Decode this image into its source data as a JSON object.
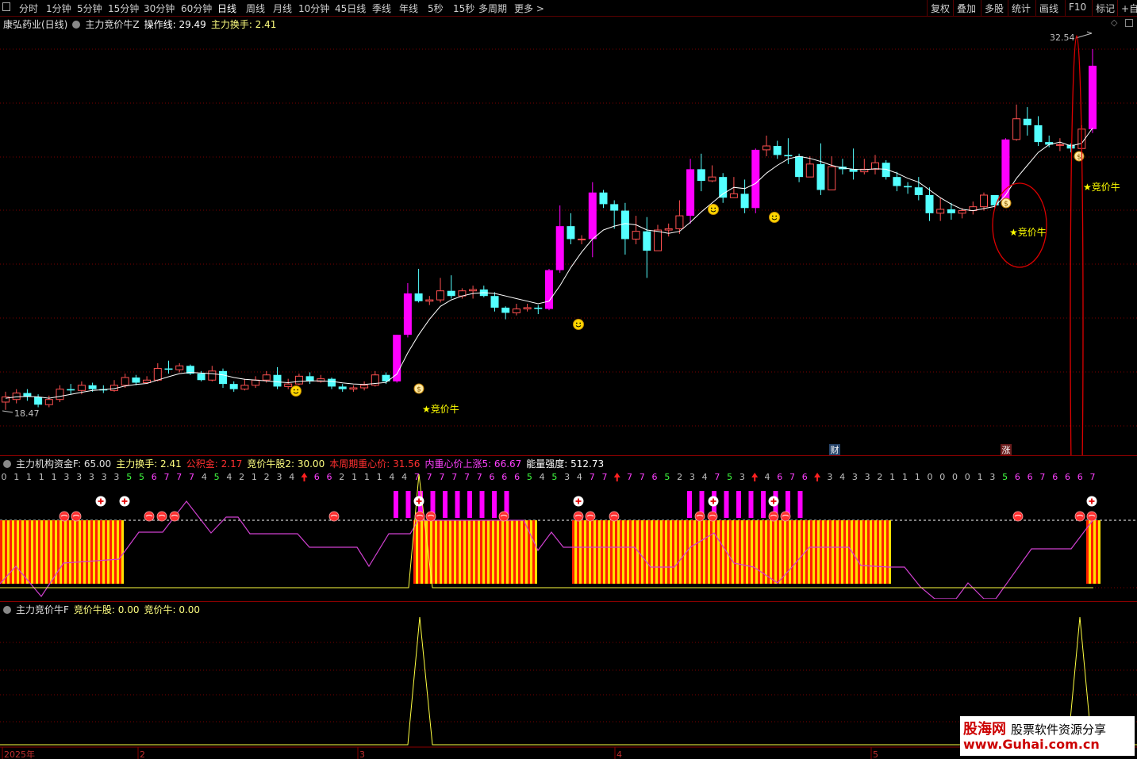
{
  "toolbar": {
    "periods": [
      "分时",
      "1分钟",
      "5分钟",
      "15分钟",
      "30分钟",
      "60分钟",
      "日线",
      "周线",
      "月线",
      "10分钟",
      "45日线",
      "季线",
      "年线",
      "5秒",
      "15秒",
      "多周期",
      "更多 >"
    ],
    "active_period": "日线",
    "right_buttons": [
      "复权",
      "叠加",
      "多股",
      "统计",
      "画线",
      "F10",
      "标记",
      "+自"
    ]
  },
  "main_panel": {
    "stock_title": "康弘药业(日线)",
    "indicator_name": "主力竞价牛Z",
    "line1_label": "操作线: 29.49",
    "line2_label": "主力换手: 2.41",
    "high_label": "32.54",
    "low_label": "18.47",
    "signal_text": "★竞价牛",
    "event_badges": [
      "财",
      "涨"
    ]
  },
  "indicator_panel": {
    "name": "主力机构资金F",
    "value": ": 65.00",
    "items": [
      {
        "label": "主力换手: 2.41",
        "color": "#ffff80"
      },
      {
        "label": "公积金: 2.17",
        "color": "#ff3030"
      },
      {
        "label": "竞价牛股2: 30.00",
        "color": "#ffff80"
      },
      {
        "label": "本周期重心价: 31.56",
        "color": "#ff3030"
      },
      {
        "label": "内重心价上涨5: 66.67",
        "color": "#ff40ff"
      },
      {
        "label": "能量强度: 512.73",
        "color": "#ffffff"
      }
    ],
    "digits": "0111133333556777454212344662111447777776665453477777652347532467673433211100001356676667"
  },
  "bottom_panel": {
    "name": "主力竞价牛F",
    "items": [
      {
        "label": "竞价牛股: 0.00",
        "color": "#ffff80"
      },
      {
        "label": "竞价牛: 0.00",
        "color": "#ffff80"
      }
    ]
  },
  "x_axis": {
    "labels": [
      "2025年",
      "2",
      "3",
      "4",
      "5"
    ]
  },
  "watermark": {
    "brand": "股海网",
    "tagline": "股票软件资源分享",
    "url": "www.Guhai.com.cn"
  },
  "colors": {
    "up": "#ff5050",
    "down": "#54ffff",
    "ma": "#ffffff",
    "magenta": "#ff00ff",
    "yellow": "#ffff00"
  },
  "chart_data": {
    "type": "candlestick",
    "title": "康弘药业(日线)",
    "price_range": [
      18.47,
      32.54
    ],
    "candles": [
      [
        18.9,
        19.1,
        19.3,
        18.6
      ],
      [
        19.0,
        19.25,
        19.4,
        18.85
      ],
      [
        19.25,
        19.1,
        19.4,
        18.95
      ],
      [
        19.1,
        18.8,
        19.2,
        18.7
      ],
      [
        18.8,
        19.0,
        19.15,
        18.7
      ],
      [
        19.0,
        19.4,
        19.55,
        18.9
      ],
      [
        19.4,
        19.35,
        19.6,
        19.2
      ],
      [
        19.35,
        19.55,
        19.7,
        19.2
      ],
      [
        19.55,
        19.4,
        19.65,
        19.3
      ],
      [
        19.4,
        19.35,
        19.55,
        19.25
      ],
      [
        19.35,
        19.55,
        19.75,
        19.3
      ],
      [
        19.55,
        19.85,
        20.0,
        19.45
      ],
      [
        19.85,
        19.65,
        19.95,
        19.55
      ],
      [
        19.65,
        19.75,
        19.9,
        19.6
      ],
      [
        19.75,
        20.2,
        20.4,
        19.7
      ],
      [
        20.2,
        20.15,
        20.5,
        20.0
      ],
      [
        20.15,
        20.3,
        20.4,
        20.05
      ],
      [
        20.3,
        20.0,
        20.35,
        19.95
      ],
      [
        20.0,
        19.75,
        20.1,
        19.7
      ],
      [
        19.75,
        20.1,
        20.3,
        19.7
      ],
      [
        20.1,
        19.6,
        20.2,
        19.45
      ],
      [
        19.6,
        19.4,
        19.7,
        19.3
      ],
      [
        19.4,
        19.55,
        19.8,
        19.35
      ],
      [
        19.55,
        19.75,
        19.9,
        19.45
      ],
      [
        19.75,
        19.95,
        20.1,
        19.65
      ],
      [
        19.95,
        19.5,
        20.25,
        19.4
      ],
      [
        19.5,
        19.6,
        19.8,
        19.4
      ],
      [
        19.6,
        19.9,
        20.0,
        19.55
      ],
      [
        19.9,
        19.7,
        20.05,
        19.6
      ],
      [
        19.7,
        19.8,
        19.95,
        19.65
      ],
      [
        19.8,
        19.5,
        19.85,
        19.4
      ],
      [
        19.5,
        19.4,
        19.6,
        19.3
      ],
      [
        19.4,
        19.45,
        19.55,
        19.3
      ],
      [
        19.45,
        19.55,
        19.7,
        19.35
      ],
      [
        19.55,
        19.95,
        20.1,
        19.5
      ],
      [
        19.95,
        19.7,
        20.05,
        19.6
      ],
      [
        19.7,
        21.5,
        21.5,
        19.65
      ],
      [
        21.5,
        23.1,
        23.5,
        21.4
      ],
      [
        23.1,
        22.8,
        24.05,
        22.75
      ],
      [
        22.8,
        22.85,
        23.0,
        22.65
      ],
      [
        22.85,
        23.2,
        23.7,
        22.75
      ],
      [
        23.2,
        23.0,
        23.8,
        22.9
      ],
      [
        23.0,
        23.2,
        23.3,
        22.9
      ],
      [
        23.2,
        23.25,
        23.4,
        22.9
      ],
      [
        23.25,
        23.0,
        23.4,
        22.95
      ],
      [
        23.0,
        22.55,
        23.15,
        22.4
      ],
      [
        22.55,
        22.35,
        22.6,
        22.1
      ],
      [
        22.35,
        22.5,
        22.7,
        22.25
      ],
      [
        22.5,
        22.55,
        22.7,
        22.4
      ],
      [
        22.55,
        22.5,
        22.65,
        22.3
      ],
      [
        22.5,
        24.0,
        24.05,
        22.45
      ],
      [
        24.0,
        25.7,
        26.5,
        23.9
      ],
      [
        25.7,
        25.2,
        26.2,
        25.0
      ],
      [
        25.2,
        25.2,
        25.35,
        25.0
      ],
      [
        25.2,
        27.0,
        27.4,
        24.5
      ],
      [
        27.0,
        26.55,
        27.1,
        26.4
      ],
      [
        26.55,
        26.3,
        26.7,
        25.6
      ],
      [
        26.3,
        25.2,
        26.6,
        24.6
      ],
      [
        25.2,
        25.5,
        26.1,
        25.0
      ],
      [
        25.5,
        24.75,
        26.05,
        23.7
      ],
      [
        24.75,
        25.55,
        25.75,
        25.1
      ],
      [
        25.55,
        25.6,
        25.8,
        25.3
      ],
      [
        25.6,
        26.1,
        26.7,
        25.4
      ],
      [
        26.1,
        27.9,
        28.3,
        25.8
      ],
      [
        27.9,
        27.45,
        28.5,
        27.05
      ],
      [
        27.45,
        27.6,
        28.05,
        27.4
      ],
      [
        27.6,
        26.8,
        27.75,
        26.6
      ],
      [
        26.8,
        26.95,
        27.6,
        26.8
      ],
      [
        26.95,
        26.4,
        27.5,
        26.2
      ],
      [
        26.4,
        28.65,
        28.7,
        26.2
      ],
      [
        28.65,
        28.8,
        29.2,
        28.4
      ],
      [
        28.8,
        28.45,
        29.0,
        28.3
      ],
      [
        28.45,
        28.4,
        29.1,
        28.1
      ],
      [
        28.4,
        27.6,
        28.5,
        27.4
      ],
      [
        27.6,
        28.1,
        28.4,
        27.6
      ],
      [
        28.1,
        27.1,
        28.9,
        26.9
      ],
      [
        27.1,
        28.0,
        28.4,
        27.2
      ],
      [
        28.0,
        27.9,
        28.3,
        27.7
      ],
      [
        27.9,
        27.8,
        28.7,
        27.5
      ],
      [
        27.8,
        27.9,
        28.3,
        27.7
      ],
      [
        27.9,
        28.15,
        28.45,
        27.7
      ],
      [
        28.15,
        27.6,
        28.25,
        27.5
      ],
      [
        27.6,
        27.25,
        27.8,
        27.05
      ],
      [
        27.25,
        27.2,
        27.4,
        26.95
      ],
      [
        27.2,
        26.9,
        27.6,
        26.7
      ],
      [
        26.9,
        26.2,
        27.2,
        25.9
      ],
      [
        26.2,
        26.35,
        26.8,
        25.9
      ],
      [
        26.35,
        26.2,
        26.6,
        25.95
      ],
      [
        26.2,
        26.3,
        26.4,
        26.0
      ],
      [
        26.3,
        26.45,
        26.65,
        26.15
      ],
      [
        26.45,
        26.9,
        27.0,
        26.3
      ],
      [
        26.9,
        26.5,
        26.9,
        26.4
      ],
      [
        26.5,
        29.05,
        29.1,
        26.45
      ],
      [
        29.05,
        29.85,
        30.4,
        29.0
      ],
      [
        29.85,
        29.6,
        30.3,
        29.2
      ],
      [
        29.6,
        28.95,
        29.95,
        28.8
      ],
      [
        28.95,
        28.85,
        29.2,
        28.75
      ],
      [
        28.85,
        28.85,
        29.1,
        28.6
      ],
      [
        28.85,
        28.7,
        28.9,
        28.55
      ],
      [
        28.7,
        29.45,
        29.6,
        28.6
      ],
      [
        29.45,
        31.9,
        32.54,
        29.3
      ]
    ],
    "ma": [
      19.05,
      19.1,
      19.12,
      19.1,
      19.05,
      19.12,
      19.2,
      19.28,
      19.35,
      19.38,
      19.42,
      19.52,
      19.58,
      19.62,
      19.75,
      19.88,
      20.0,
      20.05,
      20.02,
      20.0,
      19.95,
      19.85,
      19.78,
      19.75,
      19.72,
      19.68,
      19.65,
      19.7,
      19.72,
      19.72,
      19.7,
      19.64,
      19.6,
      19.58,
      19.62,
      19.66,
      19.98,
      20.8,
      21.5,
      22.1,
      22.6,
      22.85,
      23.0,
      23.1,
      23.13,
      23.1,
      23.0,
      22.9,
      22.8,
      22.7,
      22.8,
      23.4,
      24.1,
      24.7,
      25.2,
      25.55,
      25.7,
      25.8,
      25.75,
      25.55,
      25.5,
      25.42,
      25.5,
      25.85,
      26.25,
      26.6,
      26.95,
      27.2,
      27.15,
      27.35,
      27.75,
      28.05,
      28.3,
      28.4,
      28.32,
      28.2,
      28.05,
      27.95,
      27.9,
      27.88,
      27.92,
      27.9,
      27.75,
      27.55,
      27.4,
      27.1,
      26.8,
      26.55,
      26.35,
      26.3,
      26.38,
      26.46,
      26.9,
      27.55,
      28.05,
      28.55,
      28.85,
      28.95,
      28.8,
      28.9,
      29.49
    ]
  }
}
